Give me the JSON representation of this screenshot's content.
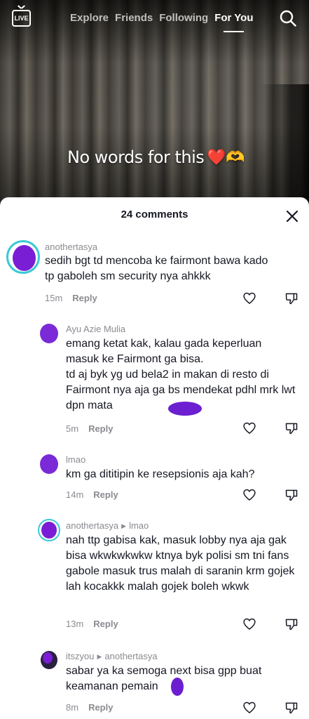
{
  "top_bar": {
    "live_label": "LIVE",
    "tabs": [
      {
        "label": "Explore",
        "active": false
      },
      {
        "label": "Friends",
        "active": false
      },
      {
        "label": "Following",
        "active": false
      },
      {
        "label": "For You",
        "active": true
      }
    ],
    "search_icon": "search-icon"
  },
  "video": {
    "caption": "No words for this",
    "caption_emojis": "❤️🫶"
  },
  "comments_sheet": {
    "title": "24 comments",
    "close_icon": "close-icon",
    "accent_color": "#39c9d6",
    "comments": [
      {
        "username": "anothertasya",
        "reply_to": "",
        "text": "sedih bgt td mencoba ke fairmont bawa kado tp gaboleh sm security nya ahkkk",
        "time": "15m",
        "reply_label": "Reply"
      },
      {
        "username": "Ayu Azie Mulia",
        "reply_to": "",
        "text": "emang ketat kak, kalau gada keperluan masuk ke Fairmont ga bisa.\ntd aj byk yg ud bela2 in makan di resto di Fairmont nya aja ga bs mendekat pdhl mrk lwt dpn mata",
        "time": "5m",
        "reply_label": "Reply"
      },
      {
        "username": "lmao",
        "reply_to": "",
        "text": "km ga dititipin ke resepsionis aja kah?",
        "time": "14m",
        "reply_label": "Reply"
      },
      {
        "username": "anothertasya",
        "reply_to": "lmao",
        "text": "nah ttp gabisa kak, masuk lobby nya aja gak bisa wkwkwkwkw ktnya byk polisi sm tni fans gabole masuk trus malah di saranin krm gojek lah kocakkk malah gojek boleh wkwk",
        "time": "13m",
        "reply_label": "Reply"
      },
      {
        "username": "itszyou",
        "reply_to": "anothertasya",
        "text": "sabar ya ka semoga next bisa gpp buat keamanan pemain",
        "time": "8m",
        "reply_label": "Reply"
      }
    ]
  }
}
